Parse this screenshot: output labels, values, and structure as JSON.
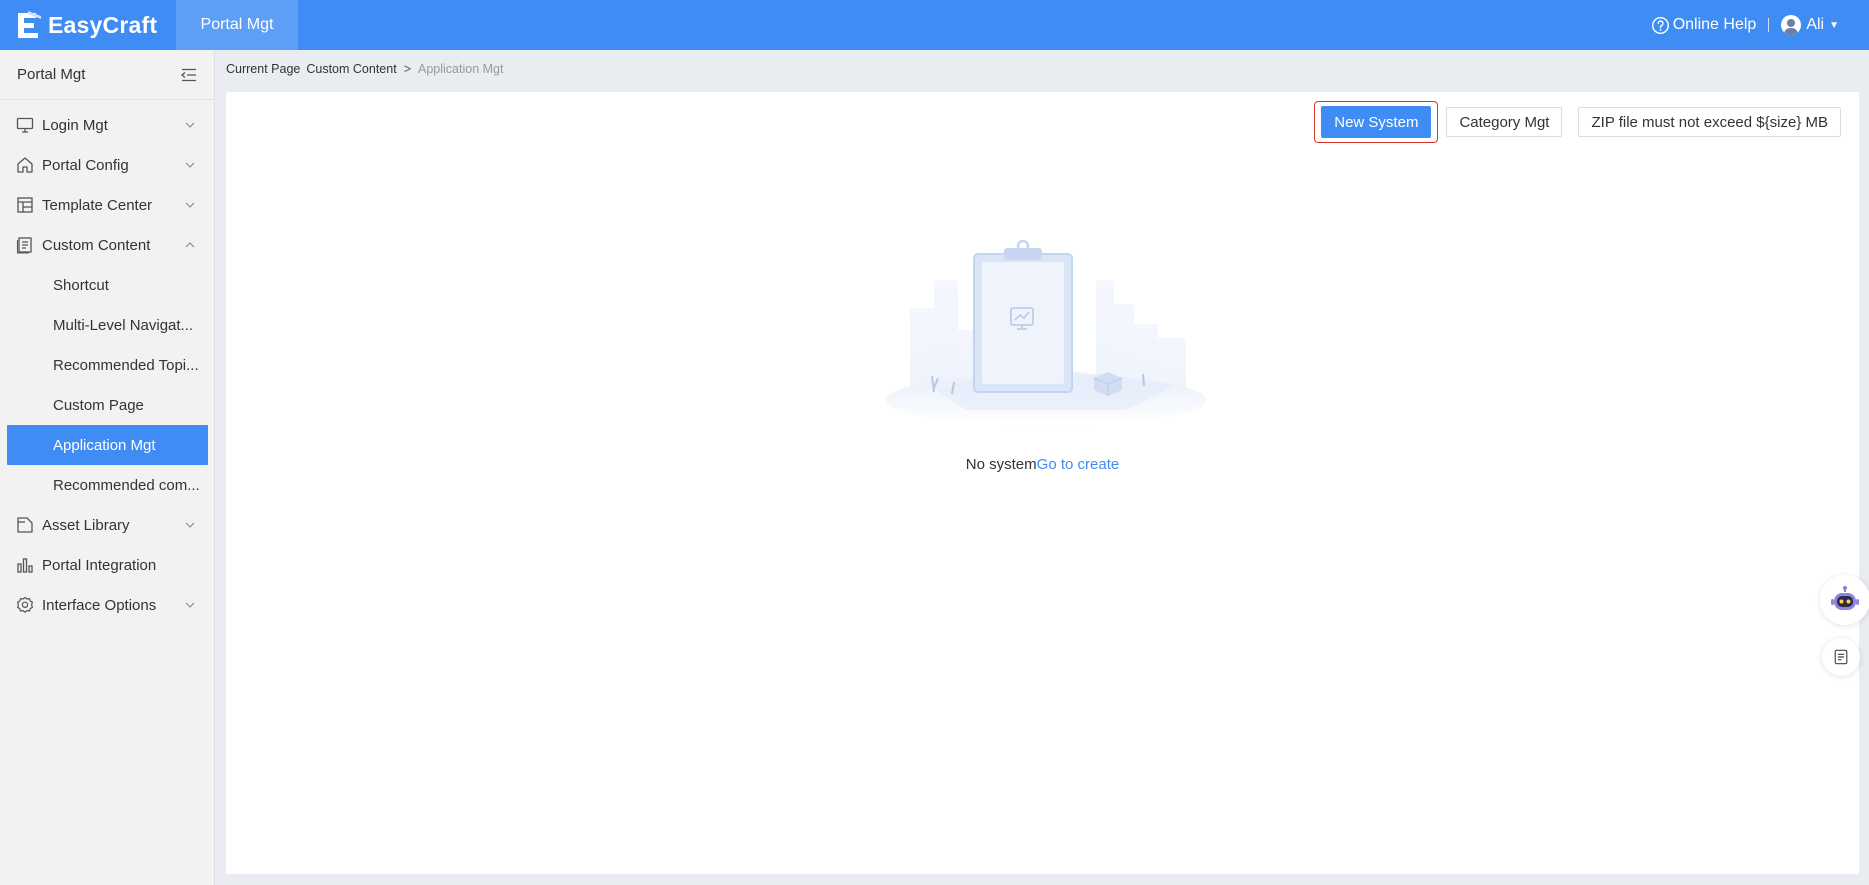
{
  "header": {
    "app_name": "EasyCraft",
    "active_tab": "Portal Mgt",
    "help_label": "Online Help",
    "user_name": "Ali",
    "brand_color": "#3f8cf4"
  },
  "sidebar": {
    "title": "Portal Mgt",
    "items": [
      {
        "label": "Login Mgt",
        "icon": "monitor-icon",
        "expanded": false
      },
      {
        "label": "Portal Config",
        "icon": "home-icon",
        "expanded": false
      },
      {
        "label": "Template Center",
        "icon": "layout-icon",
        "expanded": false
      },
      {
        "label": "Custom Content",
        "icon": "document-icon",
        "expanded": true
      },
      {
        "label": "Asset Library",
        "icon": "folder-file-icon",
        "expanded": false
      },
      {
        "label": "Portal Integration",
        "icon": "bar-chart-icon",
        "expanded": false
      },
      {
        "label": "Interface Options",
        "icon": "gear-icon",
        "expanded": false
      }
    ],
    "sub_items": [
      {
        "label": "Shortcut"
      },
      {
        "label": "Multi-Level Navigat..."
      },
      {
        "label": "Recommended Topi..."
      },
      {
        "label": "Custom Page"
      },
      {
        "label": "Application Mgt",
        "active": true
      },
      {
        "label": "Recommended com..."
      }
    ]
  },
  "breadcrumb": {
    "prefix": "Current Page",
    "parent": "Custom Content",
    "separator": ">",
    "current": "Application Mgt"
  },
  "toolbar": {
    "new_system": "New System",
    "category_mgt": "Category Mgt",
    "zip_note": "ZIP file must not exceed ${size} MB"
  },
  "empty_state": {
    "text": "No system",
    "link": "Go to create"
  },
  "floating": {
    "assistant_icon": "robot-icon",
    "notes_icon": "notes-icon"
  }
}
